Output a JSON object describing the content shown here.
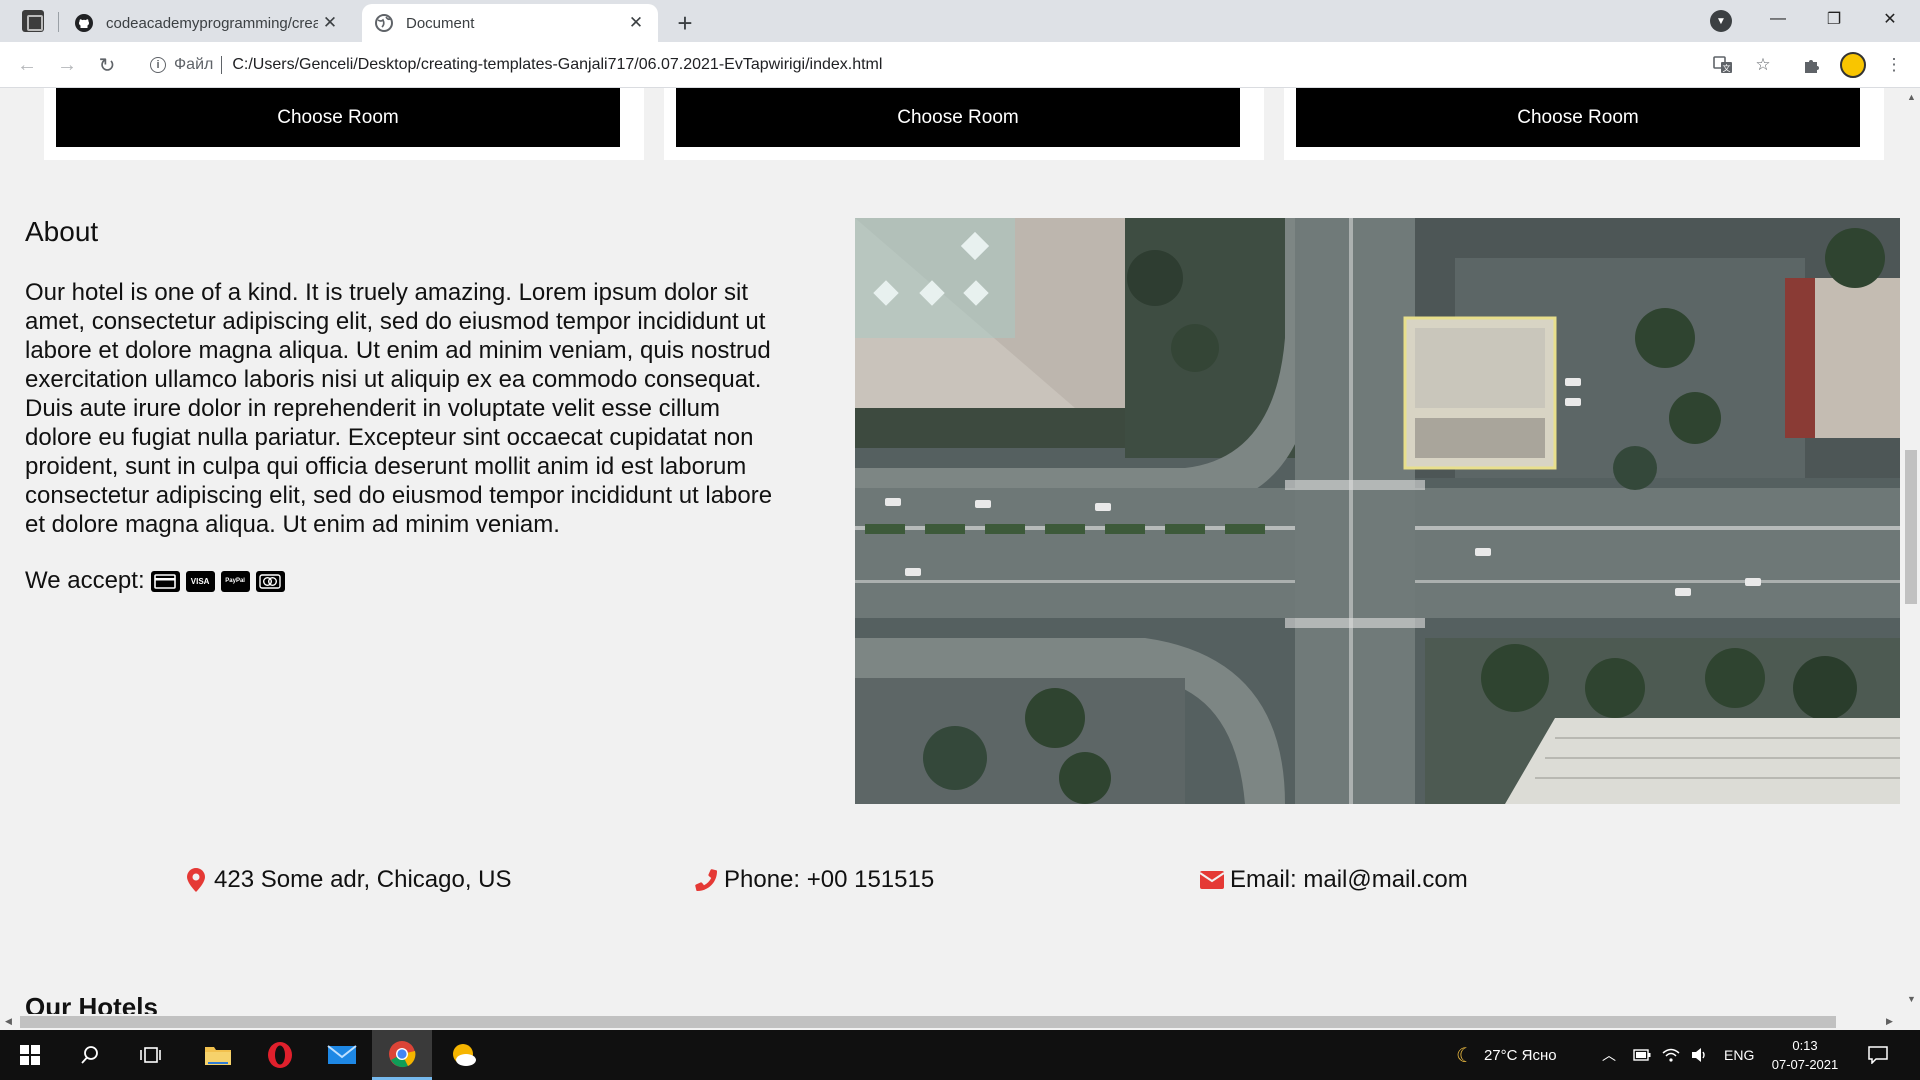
{
  "browser": {
    "tabs": [
      {
        "title": "codeacademyprogramming/crea",
        "icon": "github-icon",
        "active": false
      },
      {
        "title": "Document",
        "icon": "globe-icon",
        "active": true
      }
    ],
    "omnibox": {
      "scheme_label": "Файл",
      "url": "C:/Users/Genceli/Desktop/creating-templates-Ganjali717/06.07.2021-EvTapwirigi/index.html"
    }
  },
  "page": {
    "rooms": [
      {
        "button_label": "Choose Room"
      },
      {
        "button_label": "Choose Room"
      },
      {
        "button_label": "Choose Room"
      }
    ],
    "about": {
      "title": "About",
      "text": "Our hotel is one of a kind. It is truely amazing. Lorem ipsum dolor sit amet, consectetur adipiscing elit, sed do eiusmod tempor incididunt ut labore et dolore magna aliqua. Ut enim ad minim veniam, quis nostrud exercitation ullamco laboris nisi ut aliquip ex ea commodo consequat. Duis aute irure dolor in reprehenderit in voluptate velit esse cillum dolore eu fugiat nulla pariatur. Excepteur sint occaecat cupidatat non proident, sunt in culpa qui officia deserunt mollit anim id est laborum consectetur adipiscing elit, sed do eiusmod tempor incididunt ut labore et dolore magna aliqua. Ut enim ad minim veniam.",
      "accept_label": "We accept:",
      "payment_icons": [
        "credit-card-icon",
        "visa-icon",
        "paypal-icon",
        "mastercard-icon"
      ],
      "payment_labels": {
        "visa": "VISA",
        "paypal": "PayPal"
      },
      "image_icon": "aerial-city-intersection-image"
    },
    "contacts": [
      {
        "icon": "map-marker-icon",
        "text": "423 Some adr, Chicago, US"
      },
      {
        "icon": "phone-icon",
        "text": "Phone: +00 151515"
      },
      {
        "icon": "envelope-icon",
        "text": "Email: mail@mail.com"
      }
    ],
    "hotels_title": "Our Hotels",
    "accent_color": "#e53935"
  },
  "taskbar": {
    "weather": "27°C Ясно",
    "language": "ENG",
    "time": "0:13",
    "date": "07-07-2021"
  }
}
